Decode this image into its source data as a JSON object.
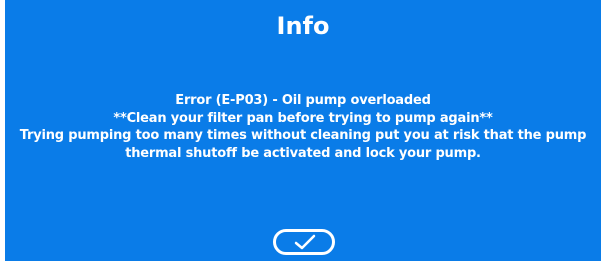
{
  "dialog": {
    "title": "Info",
    "message_lines": [
      "Error (E-P03) - Oil pump overloaded",
      "**Clean your filter pan before trying to pump again**",
      "Trying pumping too many times without cleaning put you at risk that the pump",
      "thermal shutoff be activated and lock your pump."
    ],
    "confirm_icon": "checkmark-icon",
    "background_color": "#0a7ce8",
    "text_color": "#ffffff"
  }
}
